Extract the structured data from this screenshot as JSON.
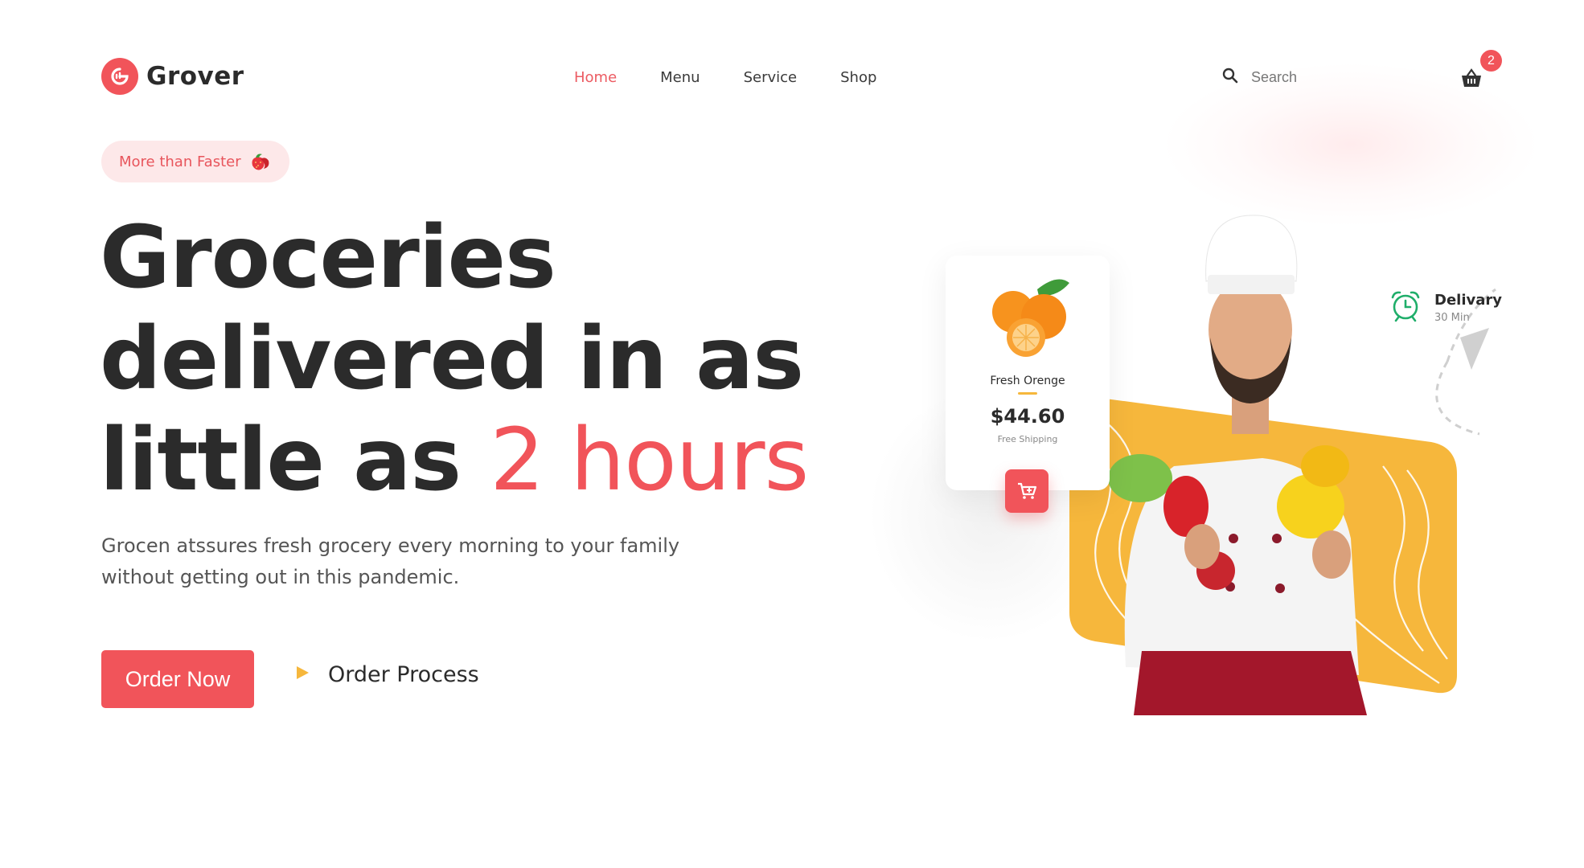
{
  "brand": {
    "name": "Grover"
  },
  "nav": {
    "items": [
      {
        "label": "Home",
        "active": true
      },
      {
        "label": "Menu",
        "active": false
      },
      {
        "label": "Service",
        "active": false
      },
      {
        "label": "Shop",
        "active": false
      }
    ]
  },
  "search": {
    "placeholder": "Search",
    "value": ""
  },
  "cart": {
    "count": "2"
  },
  "hero": {
    "tag": "More than Faster",
    "headline_line1": "Groceries",
    "headline_line2": "delivered in as",
    "headline_line3": "little as ",
    "headline_accent": "2 hours",
    "description": "Grocen atssures fresh grocery every morning to your family without getting out in this pandemic.",
    "primary_cta": "Order Now",
    "secondary_cta": "Order Process"
  },
  "product_card": {
    "name": "Fresh Orenge",
    "price": "$44.60",
    "shipping": "Free Shipping"
  },
  "delivery": {
    "title": "Delivary",
    "time": "30 Min"
  },
  "colors": {
    "accent": "#f1545a",
    "accent_soft": "#fde8e9",
    "yellow": "#f6b73c",
    "green": "#1fae6a",
    "text_dark": "#2b2b2b"
  },
  "icons": [
    "logo-mark",
    "strawberry-icon",
    "search-icon",
    "basket-icon",
    "play-icon",
    "cart-plus-icon",
    "alarm-clock-icon"
  ]
}
